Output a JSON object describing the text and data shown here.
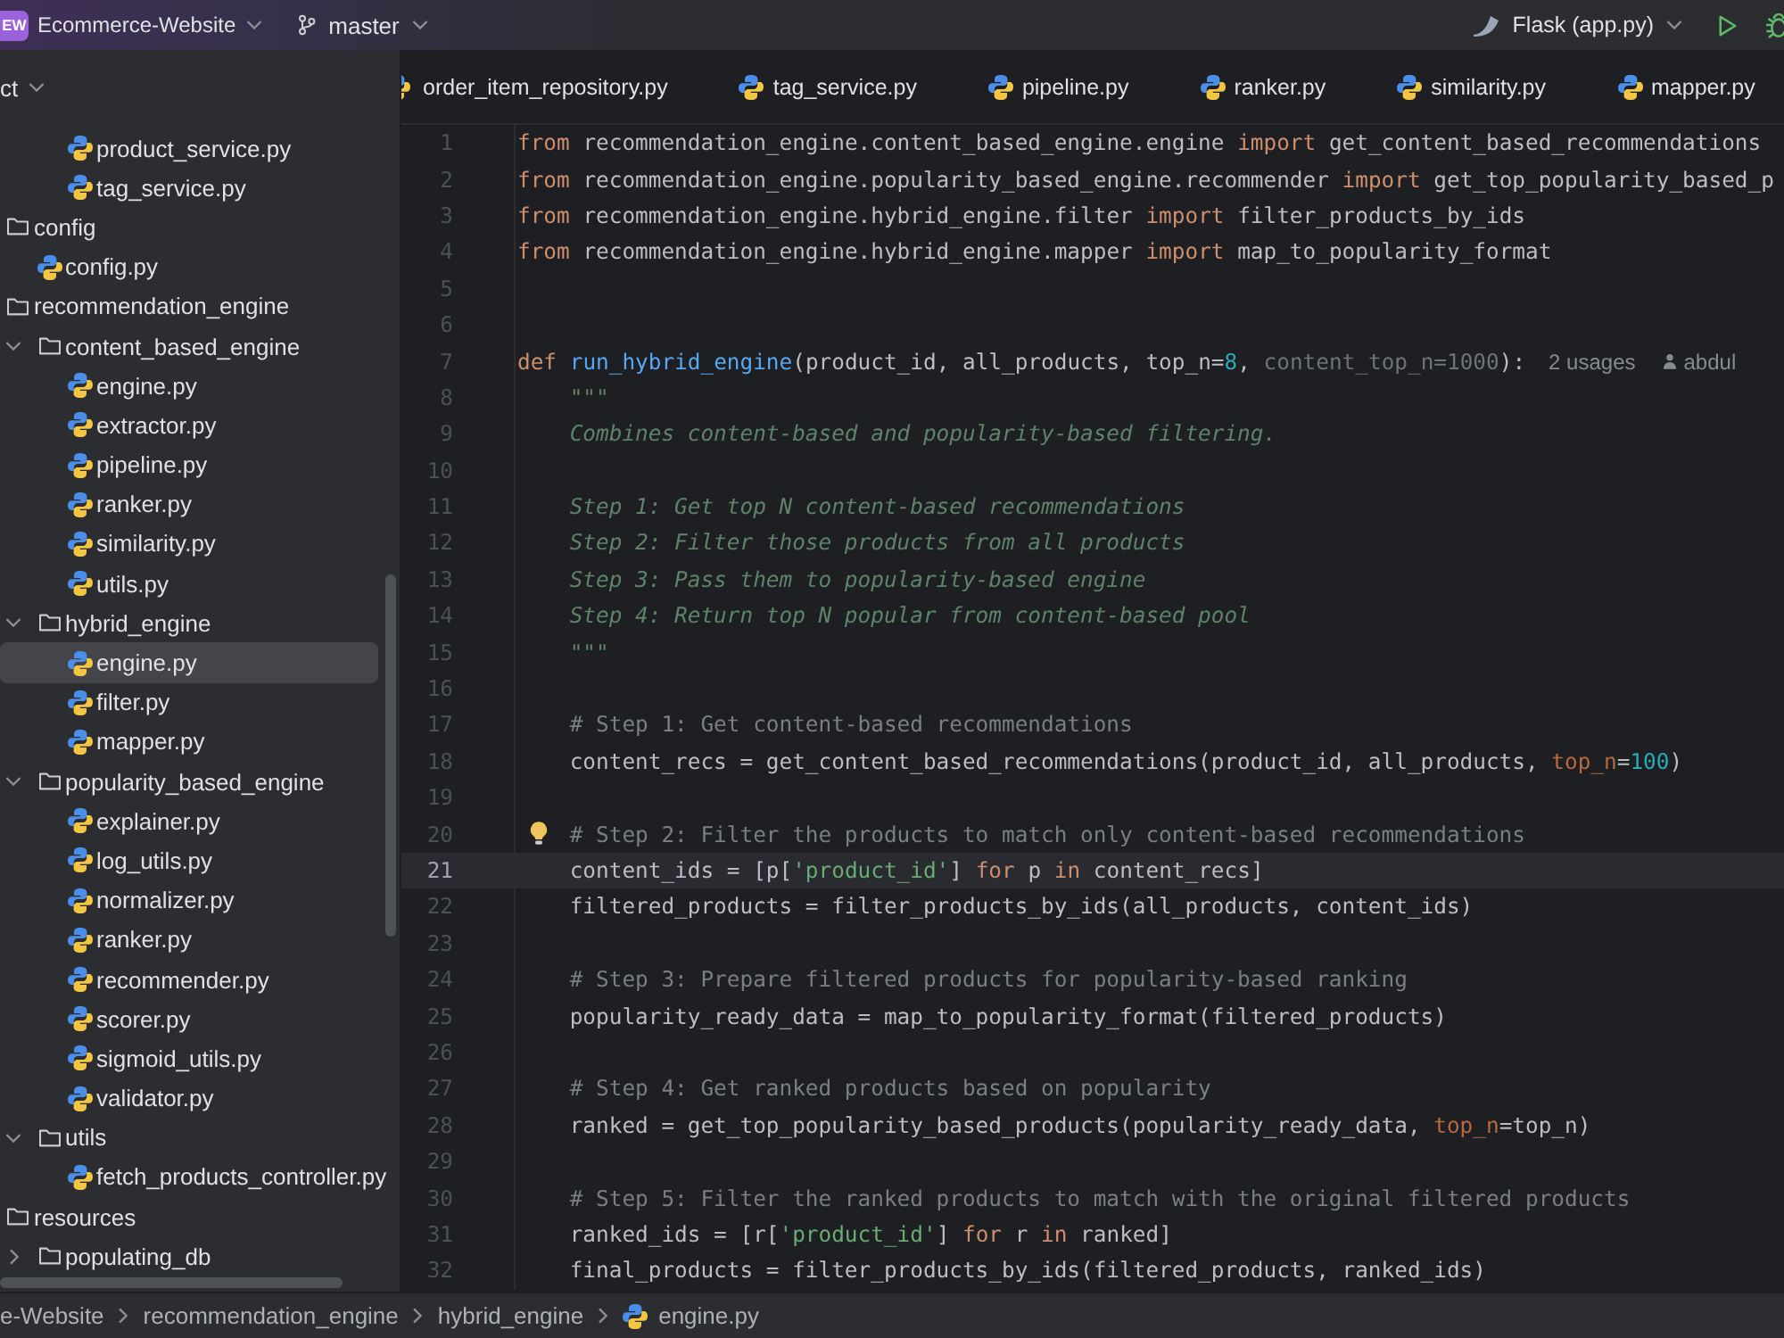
{
  "title_bar": {
    "project_badge": "EW",
    "project": "Ecommerce-Website",
    "branch": "master",
    "run_config": "Flask (app.py)"
  },
  "project_panel": {
    "title": "ct",
    "tree": [
      {
        "kind": "offscreen_folder",
        "children": [
          {
            "kind": "offscreen_folder",
            "children": [
              {
                "kind": "file",
                "label": "product_service.py",
                "selected": false
              },
              {
                "kind": "file",
                "label": "tag_service.py",
                "selected": false
              }
            ]
          }
        ]
      },
      {
        "kind": "folder",
        "label": "config",
        "selected": false,
        "children": [
          {
            "kind": "file",
            "label": "config.py",
            "selected": false
          }
        ]
      },
      {
        "kind": "folder",
        "label": "recommendation_engine",
        "selected": false,
        "children": [
          {
            "kind": "folder",
            "label": "content_based_engine",
            "expanded": true,
            "selected": false,
            "children": [
              {
                "kind": "file",
                "label": "engine.py",
                "selected": false
              },
              {
                "kind": "file",
                "label": "extractor.py",
                "selected": false
              },
              {
                "kind": "file",
                "label": "pipeline.py",
                "selected": false
              },
              {
                "kind": "file",
                "label": "ranker.py",
                "selected": false
              },
              {
                "kind": "file",
                "label": "similarity.py",
                "selected": false
              },
              {
                "kind": "file",
                "label": "utils.py",
                "selected": false
              }
            ]
          },
          {
            "kind": "folder",
            "label": "hybrid_engine",
            "expanded": true,
            "selected": false,
            "children": [
              {
                "kind": "file",
                "label": "engine.py",
                "selected": true
              },
              {
                "kind": "file",
                "label": "filter.py",
                "selected": false
              },
              {
                "kind": "file",
                "label": "mapper.py",
                "selected": false
              }
            ]
          },
          {
            "kind": "folder",
            "label": "popularity_based_engine",
            "expanded": true,
            "selected": false,
            "children": [
              {
                "kind": "file",
                "label": "explainer.py",
                "selected": false
              },
              {
                "kind": "file",
                "label": "log_utils.py",
                "selected": false
              },
              {
                "kind": "file",
                "label": "normalizer.py",
                "selected": false
              },
              {
                "kind": "file",
                "label": "ranker.py",
                "selected": false
              },
              {
                "kind": "file",
                "label": "recommender.py",
                "selected": false
              },
              {
                "kind": "file",
                "label": "scorer.py",
                "selected": false
              },
              {
                "kind": "file",
                "label": "sigmoid_utils.py",
                "selected": false
              },
              {
                "kind": "file",
                "label": "validator.py",
                "selected": false
              }
            ]
          },
          {
            "kind": "folder",
            "label": "utils",
            "expanded": true,
            "selected": false,
            "children": [
              {
                "kind": "file",
                "label": "fetch_products_controller.py",
                "selected": false
              }
            ]
          }
        ]
      },
      {
        "kind": "folder",
        "label": "resources",
        "selected": false,
        "children": [
          {
            "kind": "folder",
            "label": "populating_db",
            "expanded": false,
            "selected": false
          }
        ]
      }
    ]
  },
  "tabs": [
    {
      "label": "order_item_repository.py",
      "selected": false
    },
    {
      "label": "tag_service.py",
      "selected": false
    },
    {
      "label": "pipeline.py",
      "selected": false
    },
    {
      "label": "ranker.py",
      "selected": false
    },
    {
      "label": "similarity.py",
      "selected": false
    },
    {
      "label": "mapper.py",
      "selected": false
    }
  ],
  "editor": {
    "lines": [
      {
        "number": "1",
        "current": false,
        "bulb": false,
        "tokens": [
          {
            "kind": "keyword",
            "text": "from"
          },
          {
            "kind": "text",
            "text": " recommendation_engine.content_based_engine.engine "
          },
          {
            "kind": "keyword",
            "text": "import"
          },
          {
            "kind": "text",
            "text": " get_content_based_recommendations"
          }
        ]
      },
      {
        "number": "2",
        "current": false,
        "bulb": false,
        "tokens": [
          {
            "kind": "keyword",
            "text": "from"
          },
          {
            "kind": "text",
            "text": " recommendation_engine.popularity_based_engine.recommender "
          },
          {
            "kind": "keyword",
            "text": "import"
          },
          {
            "kind": "text",
            "text": " get_top_popularity_based_p"
          }
        ]
      },
      {
        "number": "3",
        "current": false,
        "bulb": false,
        "tokens": [
          {
            "kind": "keyword",
            "text": "from"
          },
          {
            "kind": "text",
            "text": " recommendation_engine.hybrid_engine.filter "
          },
          {
            "kind": "keyword",
            "text": "import"
          },
          {
            "kind": "text",
            "text": " filter_products_by_ids"
          }
        ]
      },
      {
        "number": "4",
        "current": false,
        "bulb": false,
        "tokens": [
          {
            "kind": "keyword",
            "text": "from"
          },
          {
            "kind": "text",
            "text": " recommendation_engine.hybrid_engine.mapper "
          },
          {
            "kind": "keyword",
            "text": "import"
          },
          {
            "kind": "text",
            "text": " map_to_popularity_format"
          }
        ]
      },
      {
        "number": "5",
        "current": false,
        "bulb": false
      },
      {
        "number": "6",
        "current": false,
        "bulb": false
      },
      {
        "number": "7",
        "current": false,
        "bulb": false,
        "tokens": [
          {
            "kind": "keyword",
            "text": "def "
          },
          {
            "kind": "function",
            "text": "run_hybrid_engine"
          },
          {
            "kind": "text",
            "text": "(product_id, all_products, top_n="
          },
          {
            "kind": "number",
            "text": "8"
          },
          {
            "kind": "text",
            "text": ", "
          },
          {
            "kind": "unused",
            "text": "content_top_n=1000"
          },
          {
            "kind": "text",
            "text": "):"
          }
        ],
        "hints": {
          "usages": "2 usages",
          "author": "abdul"
        }
      },
      {
        "number": "8",
        "current": false,
        "bulb": false,
        "tokens": [
          {
            "kind": "docstring",
            "text": "    \"\"\""
          }
        ]
      },
      {
        "number": "9",
        "current": false,
        "bulb": false,
        "tokens": [
          {
            "kind": "docstring",
            "text": "    Combines content-based and popularity-based filtering."
          }
        ]
      },
      {
        "number": "10",
        "current": false,
        "bulb": false
      },
      {
        "number": "11",
        "current": false,
        "bulb": false,
        "tokens": [
          {
            "kind": "docstring",
            "text": "    Step 1: Get top N content-based recommendations"
          }
        ]
      },
      {
        "number": "12",
        "current": false,
        "bulb": false,
        "tokens": [
          {
            "kind": "docstring",
            "text": "    Step 2: Filter those products from all products"
          }
        ]
      },
      {
        "number": "13",
        "current": false,
        "bulb": false,
        "tokens": [
          {
            "kind": "docstring",
            "text": "    Step 3: Pass them to popularity-based engine"
          }
        ]
      },
      {
        "number": "14",
        "current": false,
        "bulb": false,
        "tokens": [
          {
            "kind": "docstring",
            "text": "    Step 4: Return top N popular from content-based pool"
          }
        ]
      },
      {
        "number": "15",
        "current": false,
        "bulb": false,
        "tokens": [
          {
            "kind": "docstring",
            "text": "    \"\"\""
          }
        ]
      },
      {
        "number": "16",
        "current": false,
        "bulb": false
      },
      {
        "number": "17",
        "current": false,
        "bulb": false,
        "tokens": [
          {
            "kind": "comment",
            "text": "    # Step 1: Get content-based recommendations"
          }
        ]
      },
      {
        "number": "18",
        "current": false,
        "bulb": false,
        "tokens": [
          {
            "kind": "text",
            "text": "    content_recs = get_content_based_recommendations(product_id, all_products, "
          },
          {
            "kind": "argument",
            "text": "top_n"
          },
          {
            "kind": "text",
            "text": "="
          },
          {
            "kind": "number",
            "text": "100"
          },
          {
            "kind": "text",
            "text": ")"
          }
        ]
      },
      {
        "number": "19",
        "current": false,
        "bulb": false
      },
      {
        "number": "20",
        "current": false,
        "bulb": true,
        "tokens": [
          {
            "kind": "comment",
            "text": "    # Step 2: Filter the products to match only content-based recommendations"
          }
        ]
      },
      {
        "number": "21",
        "current": true,
        "bulb": false,
        "tokens": [
          {
            "kind": "text",
            "text": "    content_ids = [p["
          },
          {
            "kind": "string",
            "text": "'product_id'"
          },
          {
            "kind": "text",
            "text": "] "
          },
          {
            "kind": "keyword",
            "text": "for"
          },
          {
            "kind": "text",
            "text": " p "
          },
          {
            "kind": "keyword",
            "text": "in"
          },
          {
            "kind": "text",
            "text": " content_recs]"
          }
        ]
      },
      {
        "number": "22",
        "current": false,
        "bulb": false,
        "tokens": [
          {
            "kind": "text",
            "text": "    filtered_products = filter_products_by_ids(all_products, content_ids)"
          }
        ]
      },
      {
        "number": "23",
        "current": false,
        "bulb": false
      },
      {
        "number": "24",
        "current": false,
        "bulb": false,
        "tokens": [
          {
            "kind": "comment",
            "text": "    # Step 3: Prepare filtered products for popularity-based ranking"
          }
        ]
      },
      {
        "number": "25",
        "current": false,
        "bulb": false,
        "tokens": [
          {
            "kind": "text",
            "text": "    popularity_ready_data = map_to_popularity_format(filtered_products)"
          }
        ]
      },
      {
        "number": "26",
        "current": false,
        "bulb": false
      },
      {
        "number": "27",
        "current": false,
        "bulb": false,
        "tokens": [
          {
            "kind": "comment",
            "text": "    # Step 4: Get ranked products based on popularity"
          }
        ]
      },
      {
        "number": "28",
        "current": false,
        "bulb": false,
        "tokens": [
          {
            "kind": "text",
            "text": "    ranked = get_top_popularity_based_products(popularity_ready_data, "
          },
          {
            "kind": "argument",
            "text": "top_n"
          },
          {
            "kind": "text",
            "text": "=top_n)"
          }
        ]
      },
      {
        "number": "29",
        "current": false,
        "bulb": false
      },
      {
        "number": "30",
        "current": false,
        "bulb": false,
        "tokens": [
          {
            "kind": "comment",
            "text": "    # Step 5: Filter the ranked products to match with the original filtered products"
          }
        ]
      },
      {
        "number": "31",
        "current": false,
        "bulb": false,
        "tokens": [
          {
            "kind": "text",
            "text": "    ranked_ids = [r["
          },
          {
            "kind": "string",
            "text": "'product_id'"
          },
          {
            "kind": "text",
            "text": "] "
          },
          {
            "kind": "keyword",
            "text": "for"
          },
          {
            "kind": "text",
            "text": " r "
          },
          {
            "kind": "keyword",
            "text": "in"
          },
          {
            "kind": "text",
            "text": " ranked]"
          }
        ]
      },
      {
        "number": "32",
        "current": false,
        "bulb": false,
        "tokens": [
          {
            "kind": "text",
            "text": "    final_products = filter_products_by_ids(filtered_products, ranked_ids)"
          }
        ]
      }
    ]
  },
  "breadcrumbs": [
    {
      "label": "e-Website",
      "kind": "folder"
    },
    {
      "label": "recommendation_engine",
      "kind": "folder"
    },
    {
      "label": "hybrid_engine",
      "kind": "folder"
    },
    {
      "label": "engine.py",
      "kind": "file"
    }
  ]
}
